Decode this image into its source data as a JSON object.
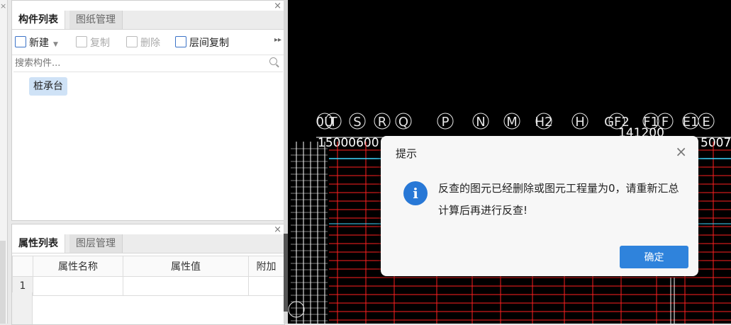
{
  "component_panel": {
    "tabs": [
      "构件列表",
      "图纸管理"
    ],
    "toolbar": {
      "new": "新建",
      "copy": "复制",
      "delete": "删除",
      "floor_copy": "层间复制"
    },
    "search_placeholder": "搜索构件...",
    "tree_items": [
      "桩承台"
    ]
  },
  "property_panel": {
    "tabs": [
      "属性列表",
      "图层管理"
    ],
    "columns": [
      "属性名称",
      "属性值",
      "附加"
    ],
    "rows": [
      {
        "index": "1",
        "name": "",
        "value": "",
        "extra": ""
      }
    ]
  },
  "cad_canvas": {
    "axis_labels": [
      "0U",
      "T",
      "S",
      "R",
      "Q",
      "P",
      "N",
      "M",
      "H2",
      "H",
      "GF2",
      "F1",
      "F",
      "E1",
      "E"
    ],
    "dimension_text_top": "15000600",
    "dimension_text_right": "141200",
    "dimension_text_far_right": "5007",
    "colors": {
      "background": "#000000",
      "grid": "#ff2020",
      "dim": "#ffffff",
      "axis": "#e8e8e8",
      "cyan": "#3fd7ff"
    }
  },
  "dialog": {
    "title": "提示",
    "message": "反查的图元已经删除或图元工程量为0，请重新汇总计算后再进行反查!",
    "ok_label": "确定",
    "icon": "info-icon"
  }
}
